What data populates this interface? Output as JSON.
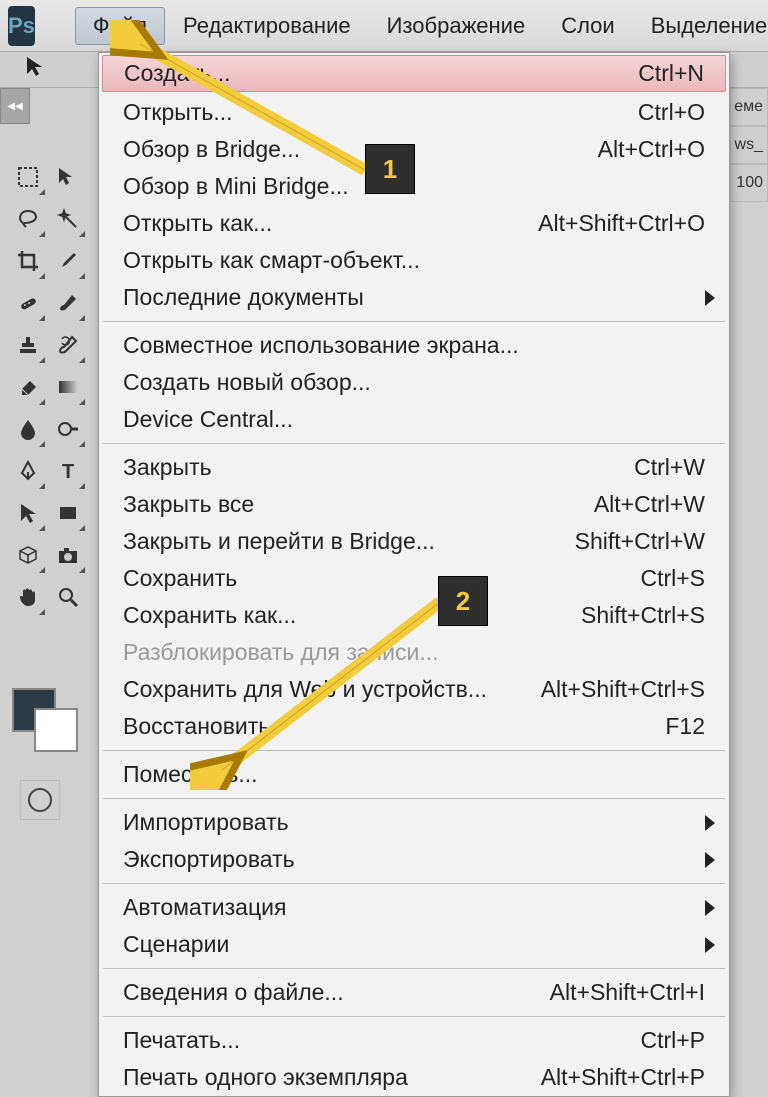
{
  "menubar": {
    "items": [
      "Файл",
      "Редактирование",
      "Изображение",
      "Слои",
      "Выделение"
    ]
  },
  "dropdown": {
    "groups": [
      [
        {
          "label": "Создать...",
          "shortcut": "Ctrl+N",
          "highlight": true
        },
        {
          "label": "Открыть...",
          "shortcut": "Ctrl+O"
        },
        {
          "label": "Обзор в Bridge...",
          "shortcut": "Alt+Ctrl+O"
        },
        {
          "label": "Обзор в Mini Bridge..."
        },
        {
          "label": "Открыть как...",
          "shortcut": "Alt+Shift+Ctrl+O"
        },
        {
          "label": "Открыть как смарт-объект..."
        },
        {
          "label": "Последние документы",
          "submenu": true
        }
      ],
      [
        {
          "label": "Совместное использование экрана..."
        },
        {
          "label": "Создать новый обзор..."
        },
        {
          "label": "Device Central..."
        }
      ],
      [
        {
          "label": "Закрыть",
          "shortcut": "Ctrl+W"
        },
        {
          "label": "Закрыть все",
          "shortcut": "Alt+Ctrl+W"
        },
        {
          "label": "Закрыть и перейти в Bridge...",
          "shortcut": "Shift+Ctrl+W"
        },
        {
          "label": "Сохранить",
          "shortcut": "Ctrl+S"
        },
        {
          "label": "Сохранить как...",
          "shortcut": "Shift+Ctrl+S"
        },
        {
          "label": "Разблокировать для записи...",
          "disabled": true
        },
        {
          "label": "Сохранить для Web и устройств...",
          "shortcut": "Alt+Shift+Ctrl+S"
        },
        {
          "label": "Восстановить",
          "shortcut": "F12"
        }
      ],
      [
        {
          "label": "Поместить..."
        }
      ],
      [
        {
          "label": "Импортировать",
          "submenu": true
        },
        {
          "label": "Экспортировать",
          "submenu": true
        }
      ],
      [
        {
          "label": "Автоматизация",
          "submenu": true
        },
        {
          "label": "Сценарии",
          "submenu": true
        }
      ],
      [
        {
          "label": "Сведения о файле...",
          "shortcut": "Alt+Shift+Ctrl+I"
        }
      ],
      [
        {
          "label": "Печатать...",
          "shortcut": "Ctrl+P"
        },
        {
          "label": "Печать одного экземпляра",
          "shortcut": "Alt+Shift+Ctrl+P"
        }
      ]
    ]
  },
  "callouts": {
    "c1": "1",
    "c2": "2"
  },
  "right": {
    "tab_fragment": "еме",
    "file_fragment": "ws_",
    "zoom_fragment": "100"
  },
  "logo": "Ps"
}
